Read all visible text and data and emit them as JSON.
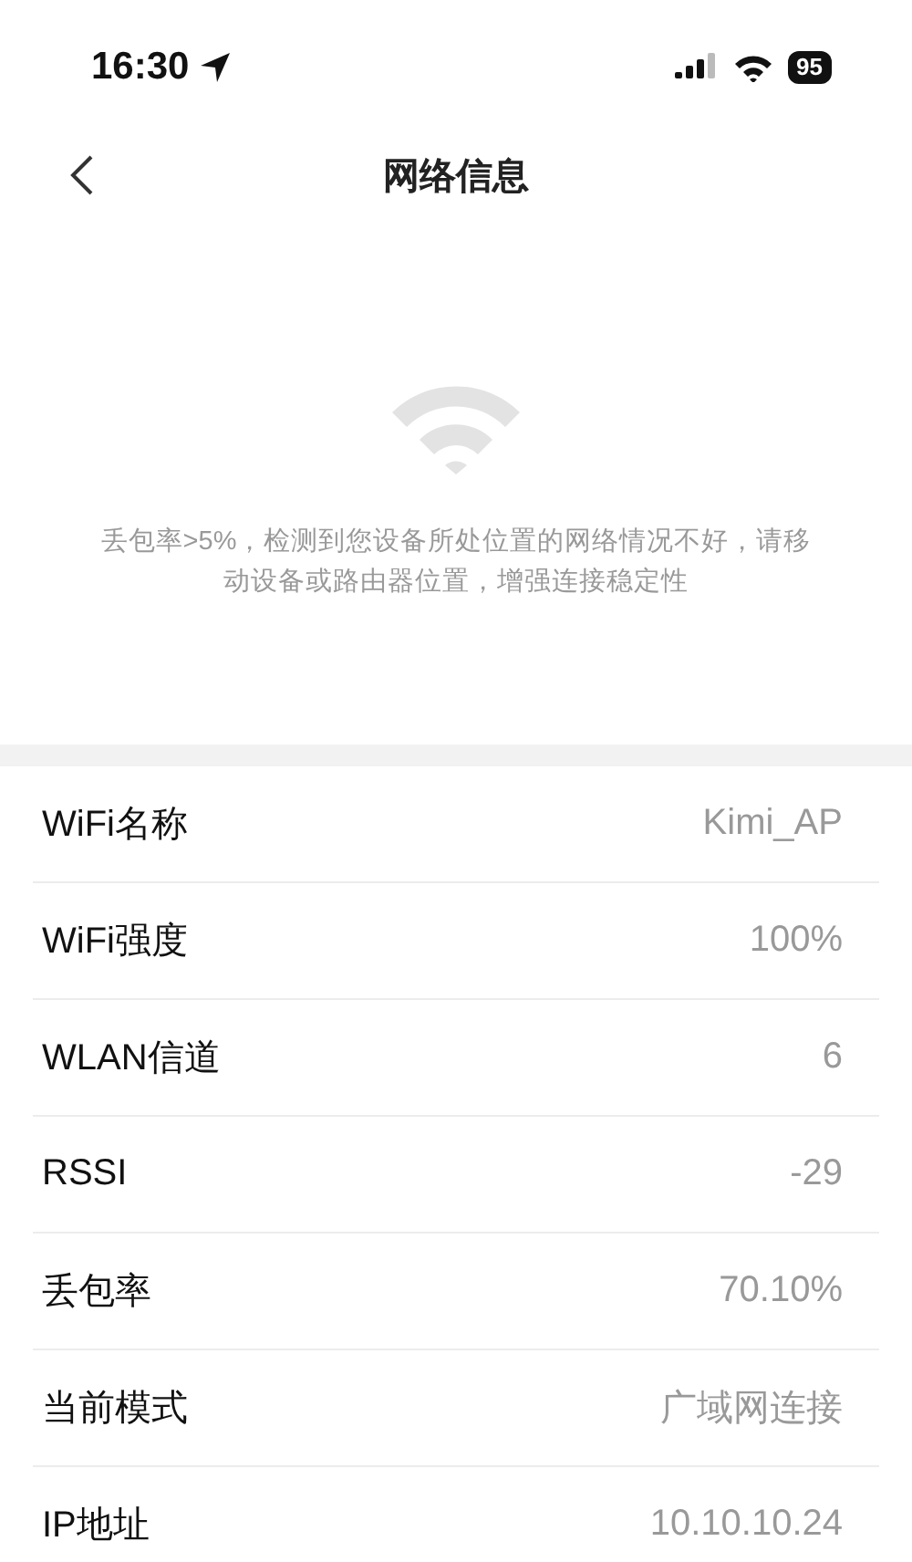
{
  "status_bar": {
    "time": "16:30",
    "battery": "95"
  },
  "nav": {
    "title": "网络信息"
  },
  "notice": {
    "message": "丢包率>5%，检测到您设备所处位置的网络情况不好，请移动设备或路由器位置，增强连接稳定性"
  },
  "rows": [
    {
      "label": "WiFi名称",
      "value": "Kimi_AP"
    },
    {
      "label": "WiFi强度",
      "value": "100%"
    },
    {
      "label": "WLAN信道",
      "value": "6"
    },
    {
      "label": "RSSI",
      "value": "-29"
    },
    {
      "label": "丢包率",
      "value": "70.10%"
    },
    {
      "label": "当前模式",
      "value": "广域网连接"
    },
    {
      "label": "IP地址",
      "value": "10.10.10.24"
    }
  ]
}
